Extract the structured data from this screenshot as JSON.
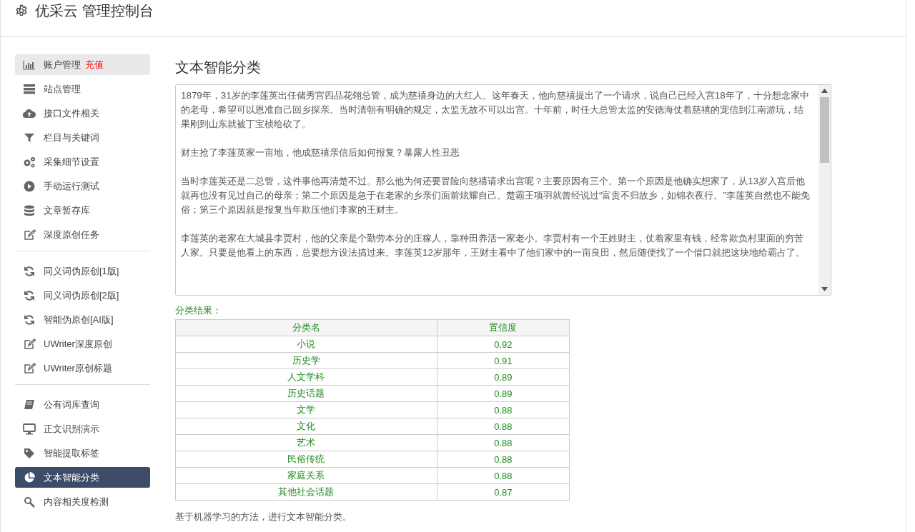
{
  "header": {
    "title": "优采云 管理控制台"
  },
  "sidebar": {
    "groups": [
      {
        "items": [
          {
            "label": "账户管理",
            "badge": "充值",
            "selected": false,
            "highlighted": true
          },
          {
            "label": "站点管理",
            "selected": false,
            "highlighted": false
          },
          {
            "label": "接口文件相关",
            "selected": false,
            "highlighted": false
          },
          {
            "label": "栏目与关键词",
            "selected": false,
            "highlighted": false
          },
          {
            "label": "采集细节设置",
            "selected": false,
            "highlighted": false
          },
          {
            "label": "手动运行测试",
            "selected": false,
            "highlighted": false
          },
          {
            "label": "文章暂存库",
            "selected": false,
            "highlighted": false
          },
          {
            "label": "深度原创任务",
            "selected": false,
            "highlighted": false
          }
        ]
      },
      {
        "items": [
          {
            "label": "同义词伪原创[1版]",
            "selected": false,
            "highlighted": false
          },
          {
            "label": "同义词伪原创[2版]",
            "selected": false,
            "highlighted": false
          },
          {
            "label": "智能伪原创[AI版]",
            "selected": false,
            "highlighted": false
          },
          {
            "label": "UWriter深度原创",
            "selected": false,
            "highlighted": false
          },
          {
            "label": "UWriter原创标题",
            "selected": false,
            "highlighted": false
          }
        ]
      },
      {
        "items": [
          {
            "label": "公有词库查询",
            "selected": false,
            "highlighted": false
          },
          {
            "label": "正文识别演示",
            "selected": false,
            "highlighted": false
          },
          {
            "label": "智能提取标签",
            "selected": false,
            "highlighted": false
          },
          {
            "label": "文本智能分类",
            "selected": true,
            "highlighted": false
          },
          {
            "label": "内容相关度检测",
            "selected": false,
            "highlighted": false
          }
        ]
      }
    ]
  },
  "main": {
    "title": "文本智能分类",
    "input_text": [
      "1879年，31岁的李莲英出任储秀宫四品花翎总管，成为慈禧身边的大红人。这年春天，他向慈禧提出了一个请求，说自己已经入宫18年了，十分想念家中的老母，希望可以恩准自己回乡探亲。当时清朝有明确的规定，太监无故不可以出宫。十年前，时任大总管太监的安德海仗着慈禧的宠信到江南游玩，结果刚到山东就被丁宝桢给砍了。",
      "财主抢了李莲英家一亩地，他成慈禧亲信后如何报复？暴露人性丑恶",
      "当时李莲英还是二总管，这件事他再清楚不过。那么他为何还要冒险向慈禧请求出宫呢？主要原因有三个。第一个原因是他确实想家了，从13岁入宫后他就再也没有见过自己的母亲；第二个原因是急于在老家的乡亲们面前炫耀自己。楚霸王项羽就曾经说过“富贵不归故乡，如锦衣夜行。”李莲英自然也不能免俗；第三个原因就是报复当年欺压他们李家的王财主。",
      "李莲英的老家在大城县李贾村，他的父亲是个勤劳本分的庄稼人，靠种田养活一家老小。李贾村有一个王姓财主，仗着家里有钱，经常欺负村里面的穷苦人家。只要是他看上的东西，总要想方设法搞过来。李莲英12岁那年，王财主看中了他们家中的一亩良田，然后随便找了一个借口就把这块地给霸占了。"
    ],
    "result_label": "分类结果：",
    "table": {
      "columns": [
        "分类名",
        "置信度"
      ],
      "rows": [
        [
          "小说",
          "0.92"
        ],
        [
          "历史学",
          "0.91"
        ],
        [
          "人文学科",
          "0.89"
        ],
        [
          "历史话题",
          "0.89"
        ],
        [
          "文学",
          "0.88"
        ],
        [
          "文化",
          "0.88"
        ],
        [
          "艺术",
          "0.88"
        ],
        [
          "民俗传统",
          "0.88"
        ],
        [
          "家庭关系",
          "0.88"
        ],
        [
          "其他社会话题",
          "0.87"
        ]
      ]
    },
    "footnote": "基于机器学习的方法，进行文本智能分类。"
  }
}
